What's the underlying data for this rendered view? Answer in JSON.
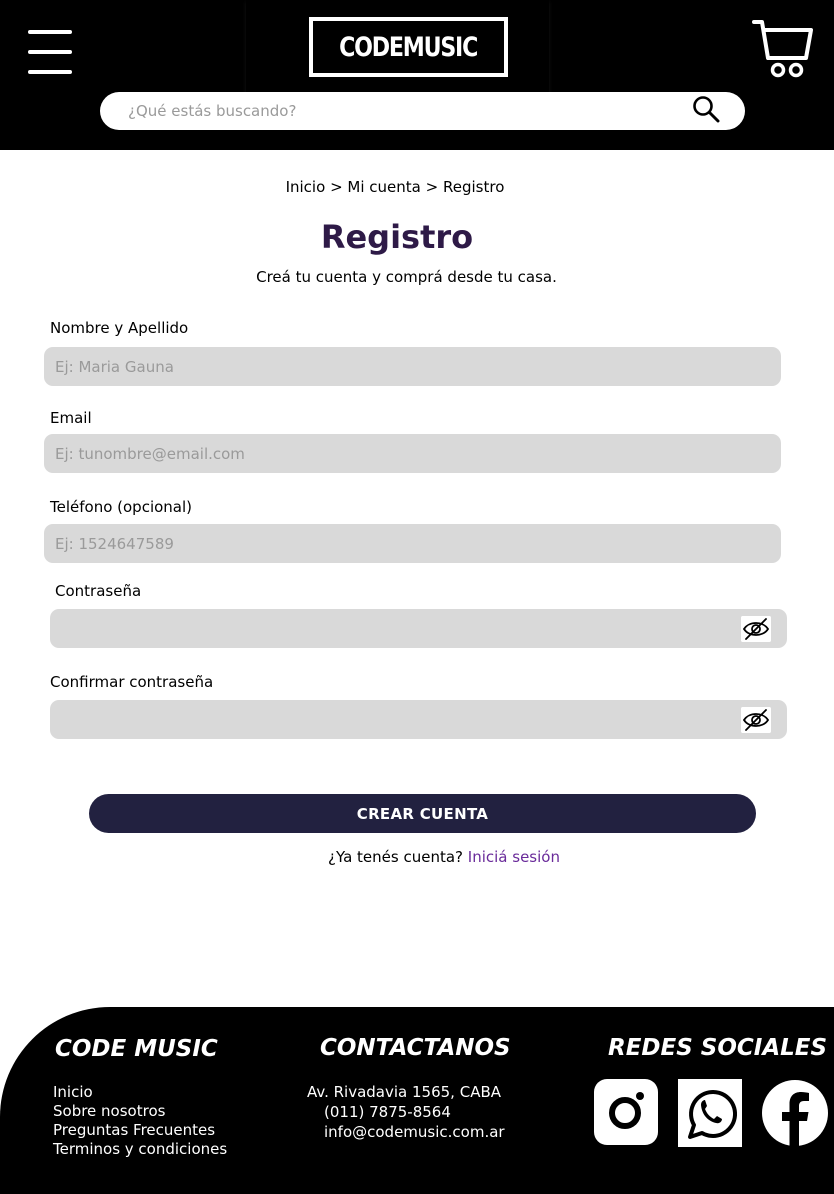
{
  "header": {
    "logo_text": "CODEMUSIC",
    "search_placeholder": "¿Qué estás buscando?"
  },
  "breadcrumb": {
    "home": "Inicio",
    "sep1": ">",
    "account": "Mi cuenta",
    "sep2": ">",
    "current": "Registro"
  },
  "form": {
    "title": "Registro",
    "subtitle": "Creá tu cuenta y comprá desde tu casa.",
    "name_label": "Nombre y Apellido",
    "name_placeholder": "Ej: Maria Gauna",
    "email_label": "Email",
    "email_placeholder": "Ej: tunombre@email.com",
    "phone_label": "Teléfono (opcional)",
    "phone_placeholder": "Ej: 1524647589",
    "password_label": "Contraseña",
    "confirm_label": "Confirmar contraseña",
    "submit_label": "CREAR CUENTA",
    "login_question": "¿Ya tenés cuenta?",
    "login_link": "Iniciá sesión"
  },
  "footer": {
    "brand_title": "CODE MUSIC",
    "links": [
      "Inicio",
      "Sobre nosotros",
      "Preguntas Frecuentes",
      "Terminos y condiciones"
    ],
    "contact_title": "CONTACTANOS",
    "address": "Av. Rivadavia 1565, CABA",
    "phone": "(011) 7875-8564",
    "email": "info@codemusic.com.ar",
    "social_title": "REDES SOCIALES",
    "social_icons": [
      "instagram-icon",
      "whatsapp-icon",
      "facebook-icon"
    ]
  },
  "colors": {
    "header_bg": "#000000",
    "title": "#2e1a47",
    "button_bg": "#222140",
    "link": "#6a2b9a",
    "field_bg": "#d9d9d9"
  }
}
